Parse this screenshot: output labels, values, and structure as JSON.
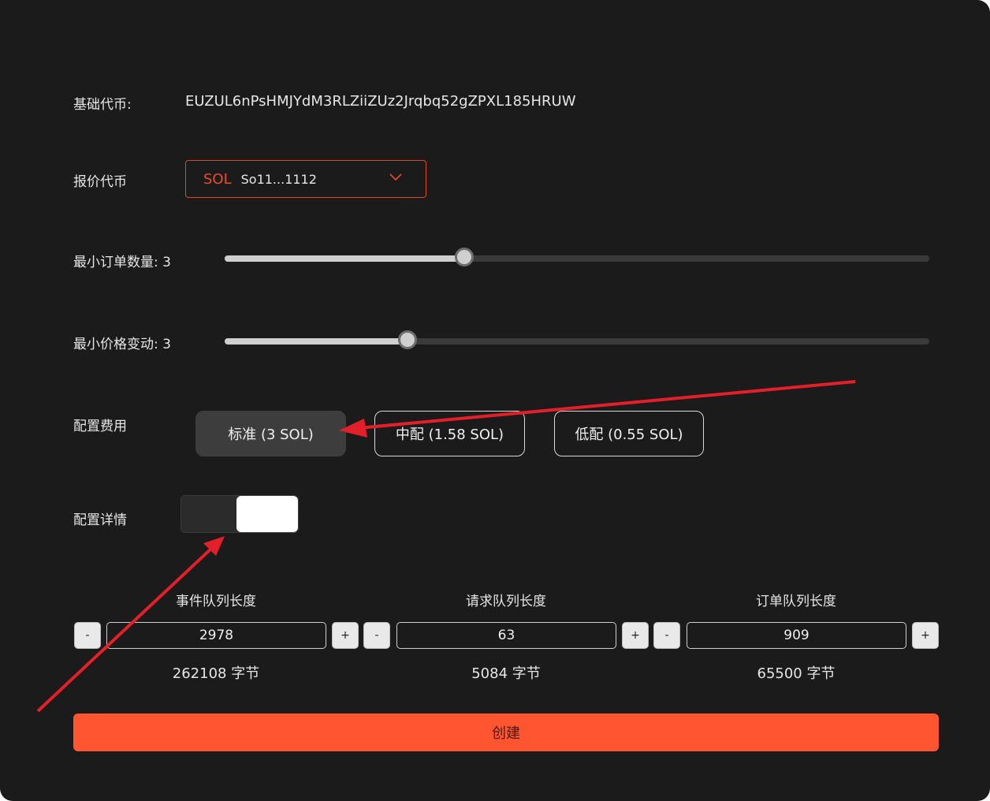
{
  "form": {
    "base_token_label": "基础代币:",
    "base_token_value": "EUZUL6nPsHMJYdM3RLZiiZUz2Jrqbq52gZPXL185HRUW",
    "quote_token_label": "报价代币",
    "quote_token_symbol": "SOL",
    "quote_token_address": "So11...1112",
    "min_order_label": "最小订单数量: 3",
    "min_order_value": 3,
    "min_order_level": 0.34,
    "min_tick_label": "最小价格变动: 3",
    "min_tick_value": 3,
    "min_tick_level": 0.26,
    "fee_label": "配置费用",
    "fee_options": [
      {
        "label": "标准 (3 SOL)",
        "active": true
      },
      {
        "label": "中配 (1.58 SOL)",
        "active": false
      },
      {
        "label": "低配 (0.55 SOL)",
        "active": false
      }
    ],
    "details_label": "配置详情",
    "details_on": true,
    "queues": [
      {
        "title": "事件队列长度",
        "value": "2978",
        "bytes": "262108 字节"
      },
      {
        "title": "请求队列长度",
        "value": "63",
        "bytes": "5084 字节"
      },
      {
        "title": "订单队列长度",
        "value": "909",
        "bytes": "65500 字节"
      }
    ],
    "minus_label": "-",
    "plus_label": "+",
    "create_label": "创建"
  },
  "colors": {
    "accent": "#ff5530",
    "quote_border": "#e0462a",
    "annotation_arrow": "#e3202a"
  }
}
